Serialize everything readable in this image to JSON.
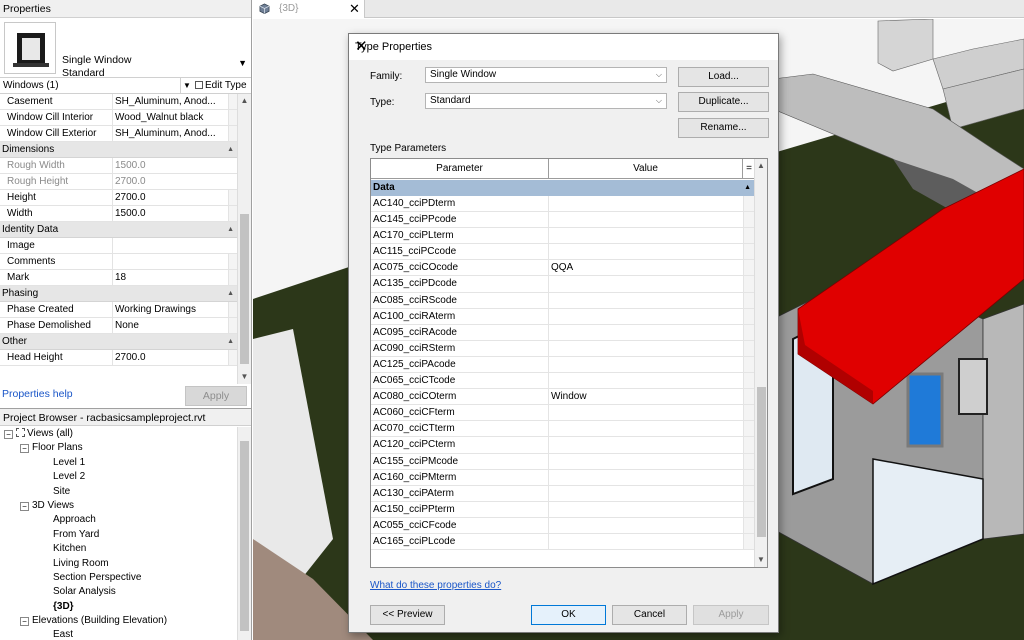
{
  "properties": {
    "title": "Properties",
    "type_family": "Single Window",
    "type_name": "Standard",
    "instance_selector": "Windows (1)",
    "edit_type_label": "Edit Type",
    "help_link": "Properties help",
    "apply_label": "Apply",
    "rows_top": [
      {
        "name": "Casement",
        "value": "SH_Aluminum, Anod..."
      },
      {
        "name": "Window Cill Interior",
        "value": "Wood_Walnut black"
      },
      {
        "name": "Window Cill Exterior",
        "value": "SH_Aluminum, Anod..."
      }
    ],
    "groups": {
      "dimensions": "Dimensions",
      "identity": "Identity Data",
      "phasing": "Phasing",
      "other": "Other"
    },
    "dimensions": [
      {
        "name": "Rough Width",
        "value": "1500.0"
      },
      {
        "name": "Rough Height",
        "value": "2700.0"
      },
      {
        "name": "Height",
        "value": "2700.0"
      },
      {
        "name": "Width",
        "value": "1500.0"
      }
    ],
    "identity": [
      {
        "name": "Image",
        "value": ""
      },
      {
        "name": "Comments",
        "value": ""
      },
      {
        "name": "Mark",
        "value": "18"
      }
    ],
    "phasing": [
      {
        "name": "Phase Created",
        "value": "Working Drawings"
      },
      {
        "name": "Phase Demolished",
        "value": "None"
      }
    ],
    "other": [
      {
        "name": "Head Height",
        "value": "2700.0"
      }
    ]
  },
  "browser": {
    "title": "Project Browser - racbasicsampleproject.rvt",
    "views_all": "Views (all)",
    "floor_plans": "Floor Plans",
    "floor_items": [
      "Level 1",
      "Level 2",
      "Site"
    ],
    "three_d_views": "3D Views",
    "three_d_items": [
      "Approach",
      "From Yard",
      "Kitchen",
      "Living Room",
      "Section Perspective",
      "Solar Analysis",
      "{3D}"
    ],
    "elevations": "Elevations (Building Elevation)",
    "elevation_items": [
      "East"
    ]
  },
  "view_tab": {
    "title": "{3D}"
  },
  "dialog": {
    "title": "Type Properties",
    "family_label": "Family:",
    "family_value": "Single Window",
    "type_label": "Type:",
    "type_value": "Standard",
    "load_label": "Load...",
    "duplicate_label": "Duplicate...",
    "rename_label": "Rename...",
    "type_params_label": "Type Parameters",
    "col_parameter": "Parameter",
    "col_value": "Value",
    "col_eq": "=",
    "group_data": "Data",
    "params": [
      {
        "name": "AC140_cciPDterm",
        "value": ""
      },
      {
        "name": "AC145_cciPPcode",
        "value": ""
      },
      {
        "name": "AC170_cciPLterm",
        "value": ""
      },
      {
        "name": "AC115_cciPCcode",
        "value": ""
      },
      {
        "name": "AC075_cciCOcode",
        "value": "QQA"
      },
      {
        "name": "AC135_cciPDcode",
        "value": ""
      },
      {
        "name": "AC085_cciRScode",
        "value": ""
      },
      {
        "name": "AC100_cciRAterm",
        "value": ""
      },
      {
        "name": "AC095_cciRAcode",
        "value": ""
      },
      {
        "name": "AC090_cciRSterm",
        "value": ""
      },
      {
        "name": "AC125_cciPAcode",
        "value": ""
      },
      {
        "name": "AC065_cciCTcode",
        "value": ""
      },
      {
        "name": "AC080_cciCOterm",
        "value": "Window"
      },
      {
        "name": "AC060_cciCFterm",
        "value": ""
      },
      {
        "name": "AC070_cciCTterm",
        "value": ""
      },
      {
        "name": "AC120_cciPCterm",
        "value": ""
      },
      {
        "name": "AC155_cciPMcode",
        "value": ""
      },
      {
        "name": "AC160_cciPMterm",
        "value": ""
      },
      {
        "name": "AC130_cciPAterm",
        "value": ""
      },
      {
        "name": "AC150_cciPPterm",
        "value": ""
      },
      {
        "name": "AC055_cciCFcode",
        "value": ""
      },
      {
        "name": "AC165_cciPLcode",
        "value": ""
      }
    ],
    "help_link": "What do these properties do?",
    "preview_label": "<< Preview",
    "ok_label": "OK",
    "cancel_label": "Cancel",
    "apply_label": "Apply"
  },
  "icons": {
    "close": "close-icon",
    "dropdown": "chevron-down-icon",
    "view3d": "cube-icon",
    "edit_type": "edit-type-icon"
  },
  "colors": {
    "roof": "#e00000",
    "grass": "#2f3a1c",
    "selected_group": "#a4bcd6",
    "link": "#1a56c8"
  }
}
